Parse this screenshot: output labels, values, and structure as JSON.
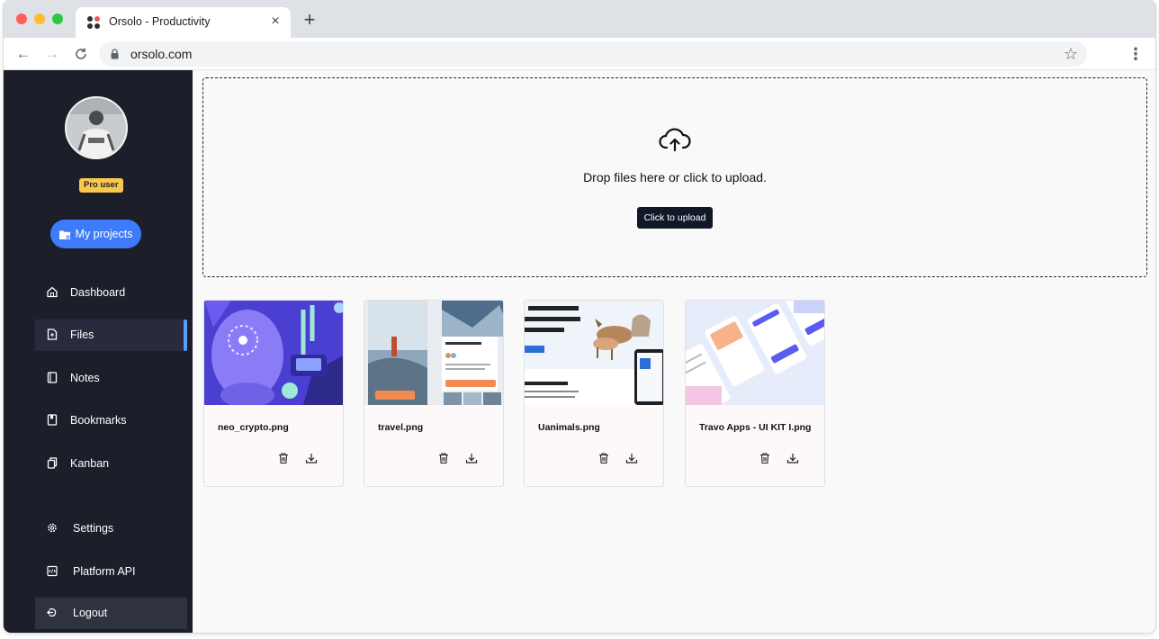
{
  "browser": {
    "tab_title": "Orsolo - Productivity",
    "url": "orsolo.com"
  },
  "sidebar": {
    "badge": "Pro user",
    "projects_button": "My projects",
    "items": [
      {
        "label": "Dashboard",
        "icon": "home-icon"
      },
      {
        "label": "Files",
        "icon": "file-icon",
        "active": true
      },
      {
        "label": "Notes",
        "icon": "notebook-icon"
      },
      {
        "label": "Bookmarks",
        "icon": "bookmark-icon"
      },
      {
        "label": "Kanban",
        "icon": "copy-icon"
      }
    ],
    "bottom_items": [
      {
        "label": "Settings",
        "icon": "gear-icon"
      },
      {
        "label": "Platform API",
        "icon": "code-icon"
      },
      {
        "label": "Logout",
        "icon": "logout-icon"
      }
    ],
    "accent_color": "#3e7bfa"
  },
  "upload": {
    "text": "Drop files here or click to upload.",
    "button": "Click to upload"
  },
  "files": [
    {
      "name": "neo_crypto.png"
    },
    {
      "name": "travel.png"
    },
    {
      "name": "Uanimals.png"
    },
    {
      "name": "Travo Apps - UI KIT I.png"
    }
  ]
}
